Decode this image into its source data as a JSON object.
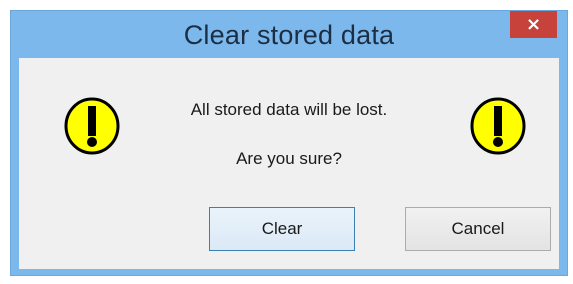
{
  "dialog": {
    "title": "Clear stored data",
    "close_label": "×",
    "message_line1": "All stored data will be lost.",
    "message_line2": "Are you sure?",
    "buttons": {
      "clear_label": "Clear",
      "cancel_label": "Cancel"
    },
    "icons": {
      "left": "warning-exclamation-icon",
      "right": "warning-exclamation-icon"
    },
    "colors": {
      "frame": "#7db8ec",
      "close_button": "#c7423a",
      "client_bg": "#f0f0f0",
      "warning_fill": "#ffff00",
      "default_button_border": "#3c7fb1"
    }
  }
}
